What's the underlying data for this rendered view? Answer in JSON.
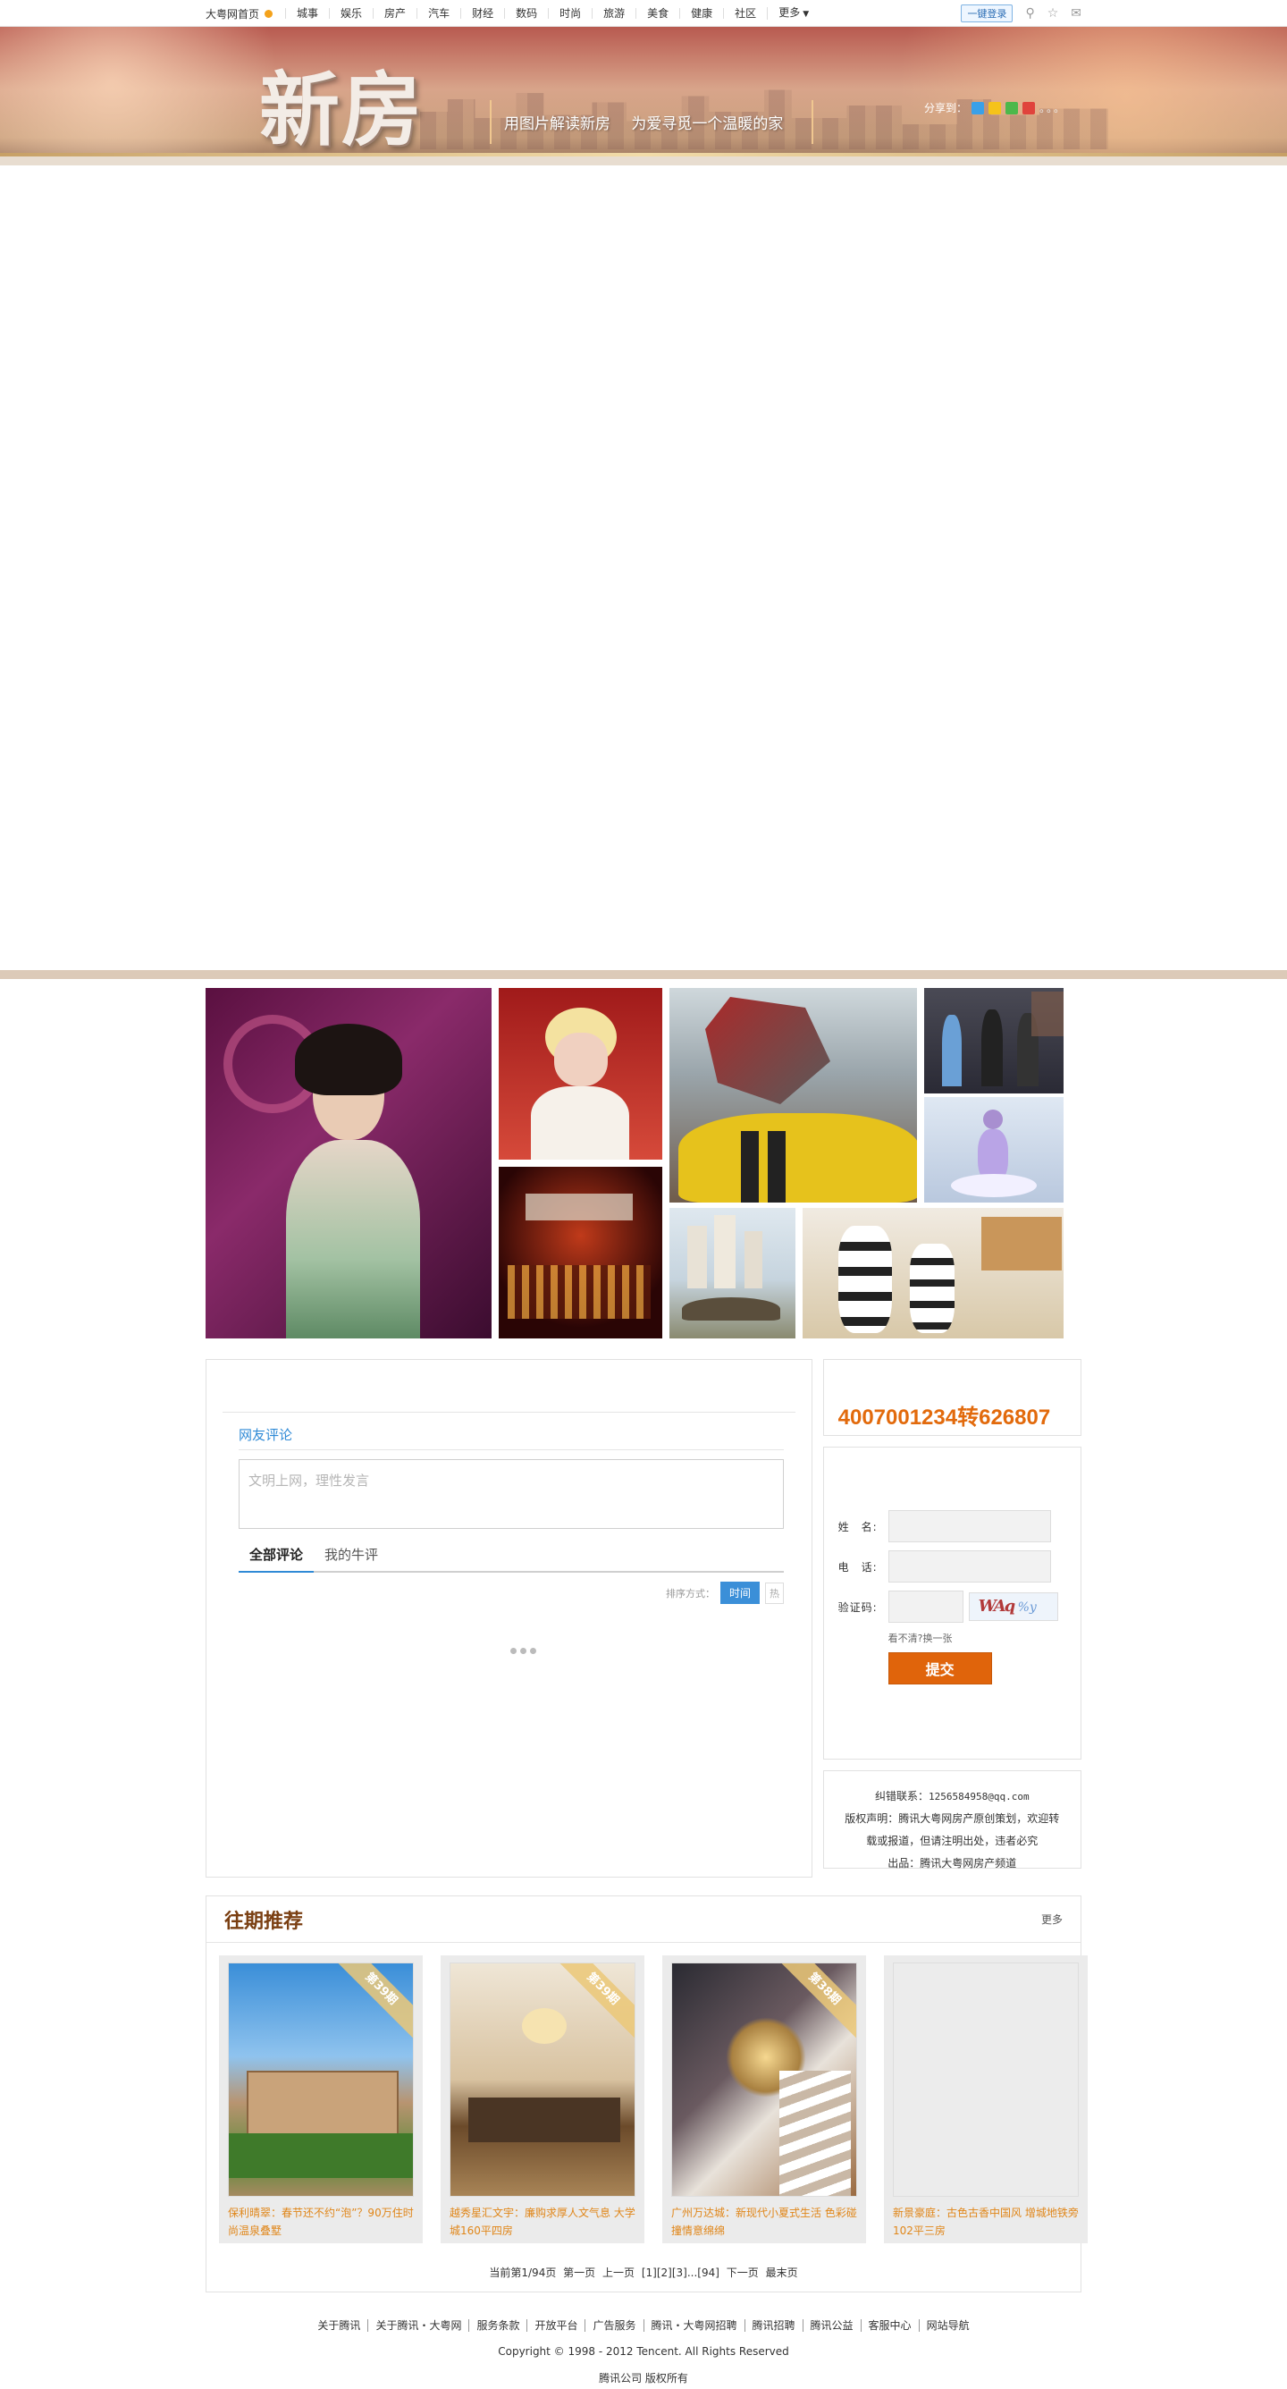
{
  "nav": {
    "home": "大粤网首页",
    "items": [
      "城事",
      "娱乐",
      "房产",
      "汽车",
      "财经",
      "数码",
      "时尚",
      "旅游",
      "美食",
      "健康",
      "社区",
      "更多"
    ],
    "login": "一键登录",
    "icons": [
      "search-icon",
      "star-icon",
      "mail-icon"
    ]
  },
  "banner": {
    "logo": "新房",
    "slogan1": "用图片解读新房",
    "slogan2": "为爱寻觅一个温暖的家",
    "share_label": "分享到：",
    "share_dots": "。。。"
  },
  "gallery": {
    "photos": [
      "wax-figure-qipao",
      "wax-figure-marilyn",
      "transformers-car",
      "stage-people",
      "red-show",
      "ballet-dancer",
      "dinosaur-city",
      "robot-showroom"
    ]
  },
  "comments": {
    "title": "网友评论",
    "placeholder": "文明上网，理性发言",
    "tab_all": "全部评论",
    "tab_mine": "我的牛评",
    "sort_label": "排序方式：",
    "sort_time": "时间",
    "sort_other": "热"
  },
  "sidebar": {
    "phone": "4007001234转626807",
    "form": {
      "name_label": "姓　名:",
      "phone_label": "电　话:",
      "captcha_label": "验证码:",
      "captcha_text": "WAq",
      "captcha_text2": "%y",
      "refresh": "看不清?换一张",
      "submit": "提交"
    },
    "info": {
      "contact_label": "纠错联系：",
      "contact_email": "1256584958@qq.com",
      "copyright1": "版权声明：腾讯大粤网房产原创策划，欢迎转",
      "copyright2": "载或报道，但请注明出处，违者必究",
      "producer": "出品：腾讯大粤网房产频道"
    }
  },
  "past": {
    "title": "往期推荐",
    "more": "更多",
    "cards": [
      {
        "ribbon": "第39期",
        "caption": "保利晴翠：春节还不约“泡”？90万住时尚温泉叠墅"
      },
      {
        "ribbon": "第39期",
        "caption": "越秀星汇文宇：廉购求厚人文气息 大学城160平四房"
      },
      {
        "ribbon": "第38期",
        "caption": "广州万达城：新现代小夏式生活 色彩碰撞情意绵绵"
      },
      {
        "ribbon": "",
        "caption": "新景豪庭：古色古香中国风 增城地铁旁102平三房"
      }
    ]
  },
  "pager": {
    "current": "当前第1/94页",
    "first": "第一页",
    "prev": "上一页",
    "pages": "[1][2][3]...[94]",
    "next": "下一页",
    "last": "最末页"
  },
  "footer": {
    "links": [
      "关于腾讯",
      "关于腾讯・大粤网",
      "服务条款",
      "开放平台",
      "广告服务",
      "腾讯・大粤网招聘",
      "腾讯招聘",
      "腾讯公益",
      "客服中心",
      "网站导航"
    ],
    "copyright": "Copyright © 1998 - 2012 Tencent. All Rights Reserved",
    "rights": "腾讯公司 版权所有"
  }
}
